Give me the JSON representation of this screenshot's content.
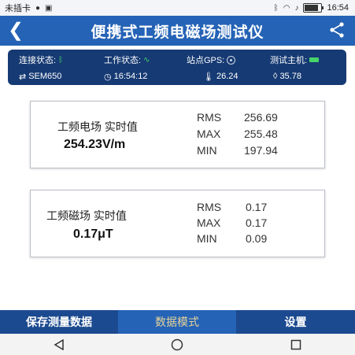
{
  "status_bar": {
    "carrier": "未插卡",
    "time": "16:54",
    "battery_percent": 0.85
  },
  "header": {
    "title": "便携式工频电磁场测试仪"
  },
  "info_panel": {
    "connection_label": "连接状态:",
    "work_label": "工作状态:",
    "gps_label": "站点GPS:",
    "host_label": "测试主机:",
    "device": "SEM650",
    "clock": "16:54:12",
    "temperature": "26.24",
    "humidity": "35.78"
  },
  "electric_card": {
    "name": "工频电场 实时值",
    "value": "254.23V/m",
    "stats": [
      {
        "label": "RMS",
        "value": "256.69"
      },
      {
        "label": "MAX",
        "value": "255.48"
      },
      {
        "label": "MIN",
        "value": "197.94"
      }
    ]
  },
  "magnetic_card": {
    "name": "工频磁场 实时值",
    "value": "0.17μT",
    "stats": [
      {
        "label": "RMS",
        "value": "0.17"
      },
      {
        "label": "MAX",
        "value": "0.17"
      },
      {
        "label": "MIN",
        "value": "0.09"
      }
    ]
  },
  "bottom_tabs": {
    "save": "保存测量数据",
    "mode": "数据模式",
    "settings": "设置"
  }
}
